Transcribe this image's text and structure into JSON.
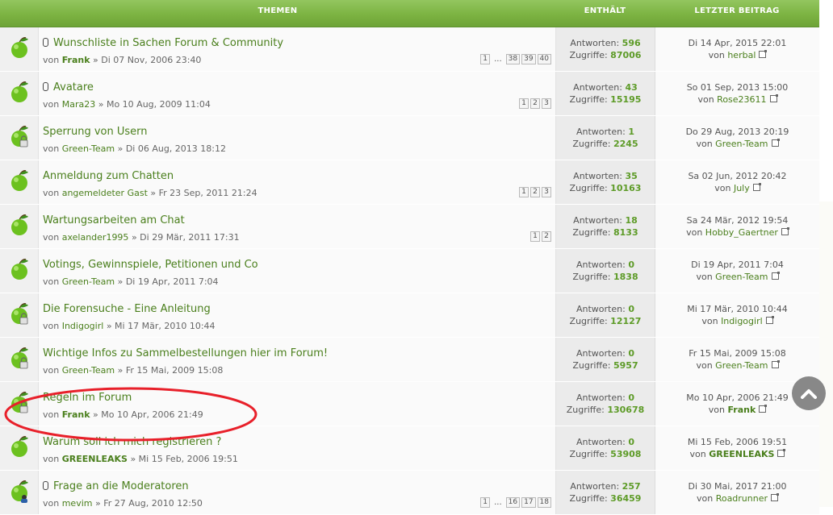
{
  "header": {
    "topics": "THEMEN",
    "stats": "ENTHÄLT",
    "last": "LETZTER BEITRAG"
  },
  "labels": {
    "by": "von",
    "replies": "Antworten:",
    "views": "Zugriffe:",
    "sep": "»"
  },
  "colors": {
    "header": "#7cb342",
    "link": "#4a7f1c",
    "value": "#5d9b27"
  },
  "topics": [
    {
      "title": "Wunschliste in Sachen Forum & Community",
      "attachment": true,
      "author": "Frank",
      "author_bold": true,
      "date": "Di 07 Nov, 2006 23:40",
      "pages": [
        "1",
        "...",
        "38",
        "39",
        "40"
      ],
      "replies": "596",
      "views": "87006",
      "last_date": "Di 14 Apr, 2015 22:01",
      "last_user": "herbal",
      "last_bold": false,
      "icon": "new-topic-icon"
    },
    {
      "title": "Avatare",
      "attachment": true,
      "author": "Mara23",
      "author_bold": false,
      "date": "Mo 10 Aug, 2009 11:04",
      "pages": [
        "1",
        "2",
        "3"
      ],
      "replies": "43",
      "views": "15195",
      "last_date": "So 01 Sep, 2013 15:00",
      "last_user": "Rose23611",
      "last_bold": false,
      "icon": "new-topic-icon"
    },
    {
      "title": "Sperrung von Usern",
      "attachment": false,
      "author": "Green-Team",
      "author_bold": false,
      "date": "Di 06 Aug, 2013 18:12",
      "pages": [],
      "replies": "1",
      "views": "2245",
      "last_date": "Do 29 Aug, 2013 20:19",
      "last_user": "Green-Team",
      "last_bold": false,
      "icon": "locked-topic-icon"
    },
    {
      "title": "Anmeldung zum Chatten",
      "attachment": false,
      "author": "angemeldeter Gast",
      "author_bold": false,
      "date": "Fr 23 Sep, 2011 21:24",
      "pages": [
        "1",
        "2",
        "3"
      ],
      "replies": "35",
      "views": "10163",
      "last_date": "Sa 02 Jun, 2012 20:42",
      "last_user": "July",
      "last_bold": false,
      "icon": "new-topic-icon"
    },
    {
      "title": "Wartungsarbeiten am Chat",
      "attachment": false,
      "author": "axelander1995",
      "author_bold": false,
      "date": "Di 29 Mär, 2011 17:31",
      "pages": [
        "1",
        "2"
      ],
      "replies": "18",
      "views": "8133",
      "last_date": "Sa 24 Mär, 2012 19:54",
      "last_user": "Hobby_Gaertner",
      "last_bold": false,
      "icon": "new-topic-icon"
    },
    {
      "title": "Votings, Gewinnspiele, Petitionen und Co",
      "attachment": false,
      "author": "Green-Team",
      "author_bold": false,
      "date": "Di 19 Apr, 2011 7:04",
      "pages": [],
      "replies": "0",
      "views": "1838",
      "last_date": "Di 19 Apr, 2011 7:04",
      "last_user": "Green-Team",
      "last_bold": false,
      "icon": "new-topic-icon"
    },
    {
      "title": "Die Forensuche - Eine Anleitung",
      "attachment": false,
      "author": "Indigogirl",
      "author_bold": false,
      "date": "Mi 17 Mär, 2010 10:44",
      "pages": [],
      "replies": "0",
      "views": "12127",
      "last_date": "Mi 17 Mär, 2010 10:44",
      "last_user": "Indigogirl",
      "last_bold": false,
      "icon": "locked-topic-icon"
    },
    {
      "title": "Wichtige Infos zu Sammelbestellungen hier im Forum!",
      "attachment": false,
      "author": "Green-Team",
      "author_bold": false,
      "date": "Fr 15 Mai, 2009 15:08",
      "pages": [],
      "replies": "0",
      "views": "5957",
      "last_date": "Fr 15 Mai, 2009 15:08",
      "last_user": "Green-Team",
      "last_bold": false,
      "icon": "locked-topic-icon"
    },
    {
      "title": "Regeln im Forum",
      "attachment": false,
      "author": "Frank",
      "author_bold": true,
      "date": "Mo 10 Apr, 2006 21:49",
      "pages": [],
      "replies": "0",
      "views": "130678",
      "last_date": "Mo 10 Apr, 2006 21:49",
      "last_user": "Frank",
      "last_bold": true,
      "icon": "locked-topic-icon"
    },
    {
      "title": "Warum soll ich mich registrieren ?",
      "attachment": false,
      "author": "GREENLEAKS",
      "author_bold": true,
      "date": "Mi 15 Feb, 2006 19:51",
      "pages": [],
      "replies": "0",
      "views": "53908",
      "last_date": "Mi 15 Feb, 2006 19:51",
      "last_user": "GREENLEAKS",
      "last_bold": true,
      "icon": "new-topic-icon"
    },
    {
      "title": "Frage an die Moderatoren",
      "attachment": true,
      "author": "mevim",
      "author_bold": false,
      "date": "Fr 27 Aug, 2010 12:50",
      "pages": [
        "1",
        "...",
        "16",
        "17",
        "18"
      ],
      "replies": "257",
      "views": "36459",
      "last_date": "Di 30 Mai, 2017 21:00",
      "last_user": "Roadrunner",
      "last_bold": false,
      "icon": "moderator-topic-icon"
    }
  ]
}
